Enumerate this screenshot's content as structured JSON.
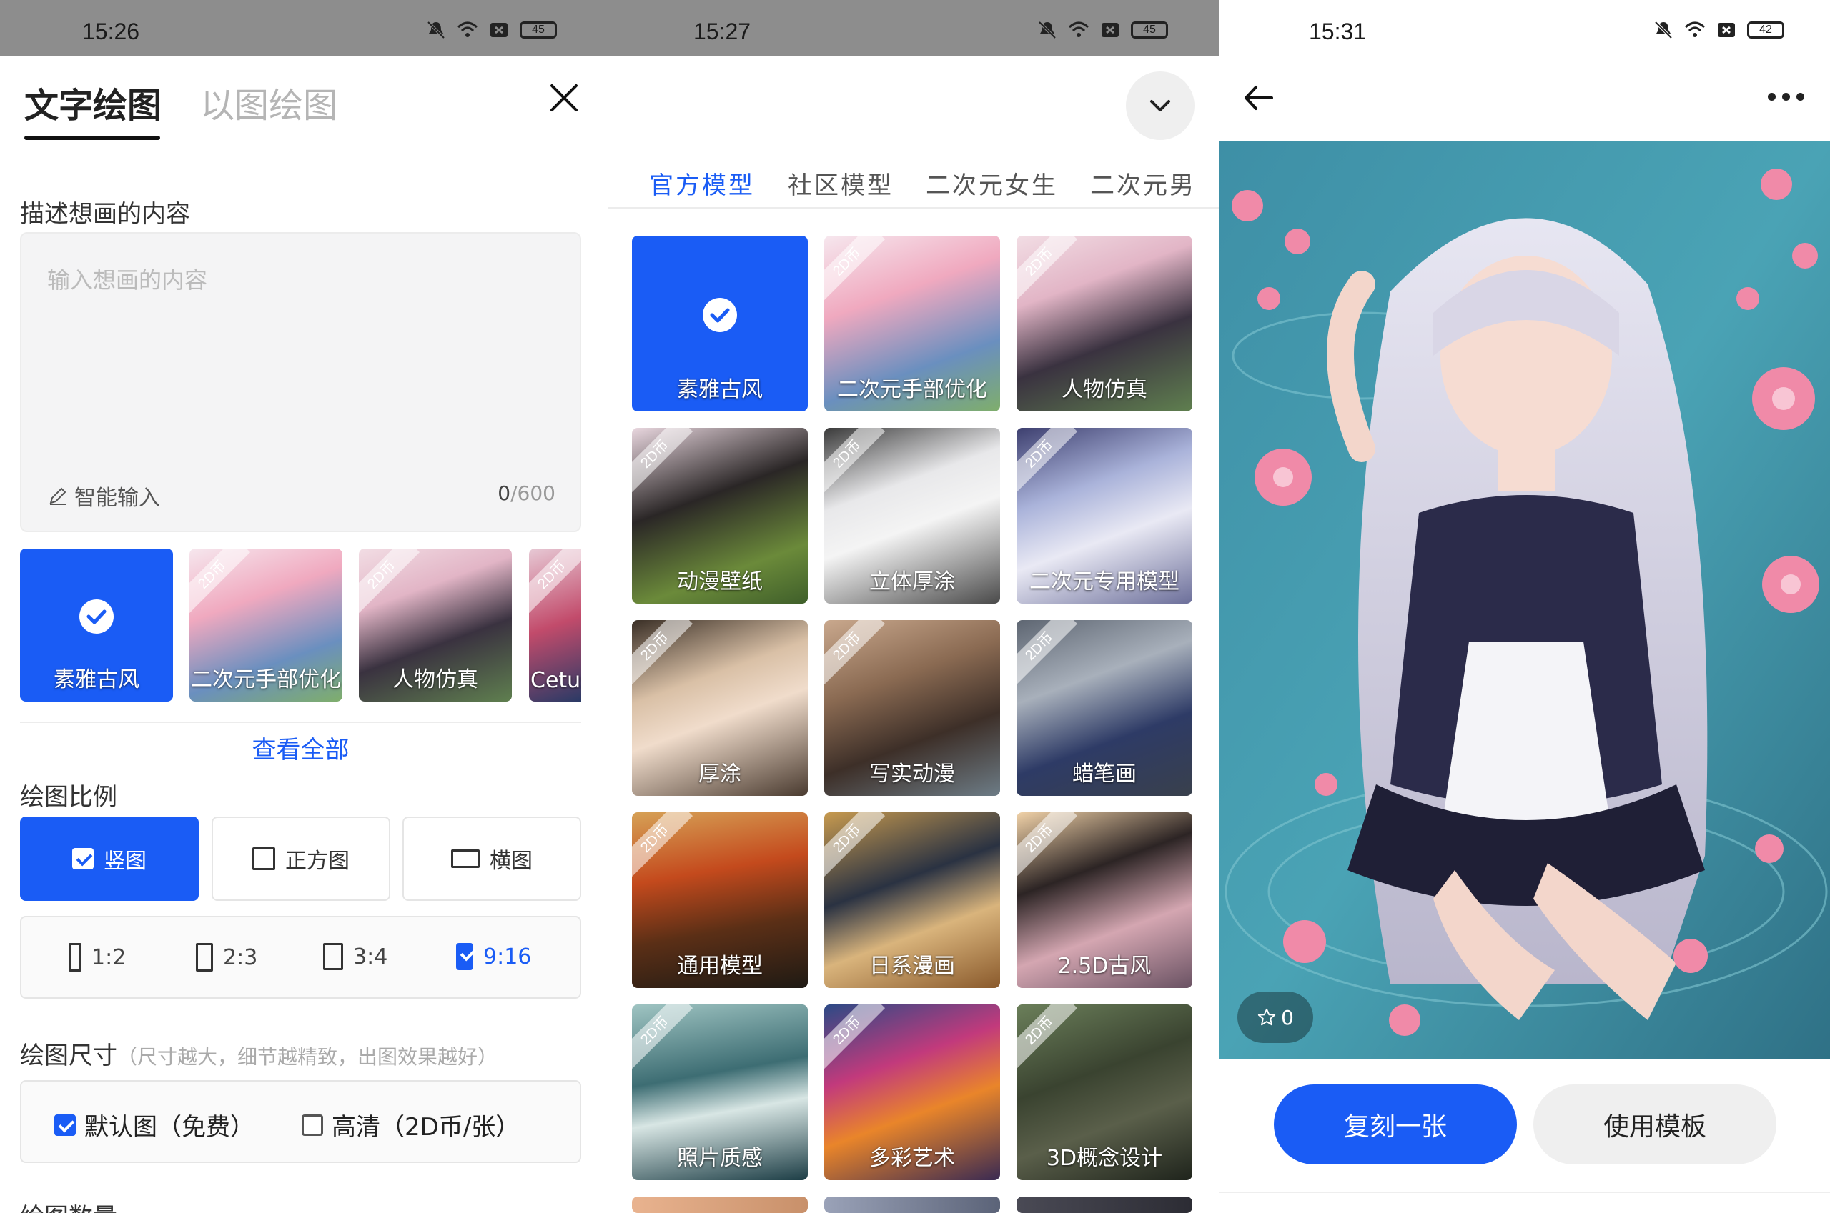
{
  "colors": {
    "accent": "#1a5cf5",
    "status_bar_gray": "#8d8d8d"
  },
  "left": {
    "status": {
      "time": "15:26",
      "battery": "45"
    },
    "tabs": [
      "文字绘图",
      "以图绘图"
    ],
    "describe_label": "描述想画的内容",
    "prompt_placeholder": "输入想画的内容",
    "smart_input": "智能输入",
    "char_count": "0",
    "char_max": "/600",
    "styles": [
      {
        "name": "素雅古风",
        "selected": true
      },
      {
        "name": "二次元手部优化",
        "badge": "2D币"
      },
      {
        "name": "人物仿真",
        "badge": "2D币"
      },
      {
        "name": "Cetus",
        "badge": "2D币"
      }
    ],
    "see_all": "查看全部",
    "ratio_label": "绘图比例",
    "ratios": [
      {
        "label": "竖图",
        "selected": true
      },
      {
        "label": "正方图"
      },
      {
        "label": "横图"
      }
    ],
    "sub_ratios": [
      {
        "label": "1:2"
      },
      {
        "label": "2:3"
      },
      {
        "label": "3:4"
      },
      {
        "label": "9:16",
        "selected": true
      }
    ],
    "size_label": "绘图尺寸",
    "size_hint": "（尺寸越大，细节越精致，出图效果越好）",
    "sizes": [
      {
        "label": "默认图（免费）",
        "selected": true
      },
      {
        "label": "高清（2D币/张）"
      }
    ],
    "count_label": "绘图数量"
  },
  "middle": {
    "status": {
      "time": "15:27",
      "battery": "45"
    },
    "categories": [
      "官方模型",
      "社区模型",
      "二次元女生",
      "二次元男"
    ],
    "models": [
      {
        "name": "素雅古风",
        "selected": true
      },
      {
        "name": "二次元手部优化",
        "badge": "2D币"
      },
      {
        "name": "人物仿真",
        "badge": "2D币"
      },
      {
        "name": "动漫壁纸",
        "badge": "2D币"
      },
      {
        "name": "立体厚涂",
        "badge": "2D币"
      },
      {
        "name": "二次元专用模型",
        "badge": "2D币"
      },
      {
        "name": "厚涂",
        "badge": "2D币"
      },
      {
        "name": "写实动漫",
        "badge": "2D币"
      },
      {
        "name": "蜡笔画",
        "badge": "2D币"
      },
      {
        "name": "通用模型",
        "badge": "2D币"
      },
      {
        "name": "日系漫画",
        "badge": "2D币"
      },
      {
        "name": "2.5D古风",
        "badge": "2D币"
      },
      {
        "name": "照片质感",
        "badge": "2D币"
      },
      {
        "name": "多彩艺术",
        "badge": "2D币"
      },
      {
        "name": "3D概念设计",
        "badge": "2D币"
      }
    ]
  },
  "right": {
    "status": {
      "time": "15:31",
      "battery": "42"
    },
    "likes": "0",
    "primary_button": "复刻一张",
    "secondary_button": "使用模板"
  }
}
